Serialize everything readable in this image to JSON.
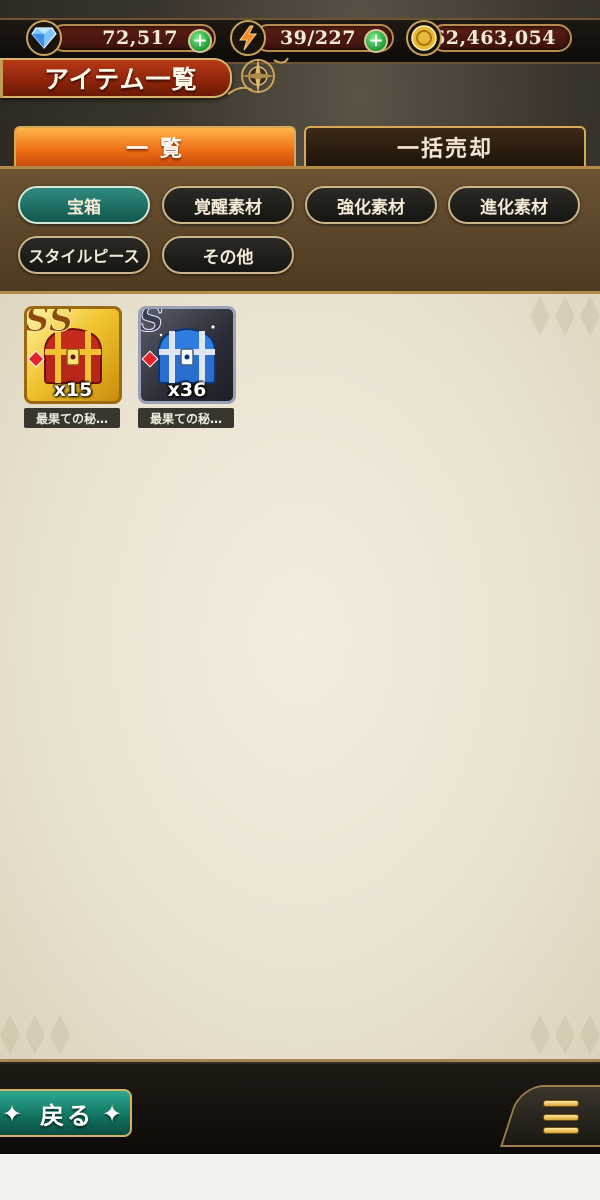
{
  "resources": {
    "gems": "72,517",
    "stamina": "39/227",
    "gold": "62,463,054"
  },
  "header": {
    "title": "アイテム一覧"
  },
  "tabs": [
    {
      "label": "一 覧",
      "active": true
    },
    {
      "label": "一括売却",
      "active": false
    }
  ],
  "filters": [
    {
      "label": "宝箱",
      "active": true
    },
    {
      "label": "覚醒素材",
      "active": false
    },
    {
      "label": "強化素材",
      "active": false
    },
    {
      "label": "進化素材",
      "active": false
    },
    {
      "label": "スタイルピース",
      "active": false
    },
    {
      "label": "その他",
      "active": false
    }
  ],
  "items": [
    {
      "name": "最果ての秘…",
      "quantity": "x15",
      "rarity": "SS",
      "icon": "red-gold-treasure-chest-icon"
    },
    {
      "name": "最果ての秘…",
      "quantity": "x36",
      "rarity": "S",
      "icon": "blue-silver-treasure-chest-icon"
    }
  ],
  "footer": {
    "back_label": "戻る",
    "menu_icon": "hamburger-menu-icon"
  },
  "colors": {
    "tab_active": "#f0731a",
    "filter_active": "#2e8a7d",
    "back_button": "#137563"
  }
}
